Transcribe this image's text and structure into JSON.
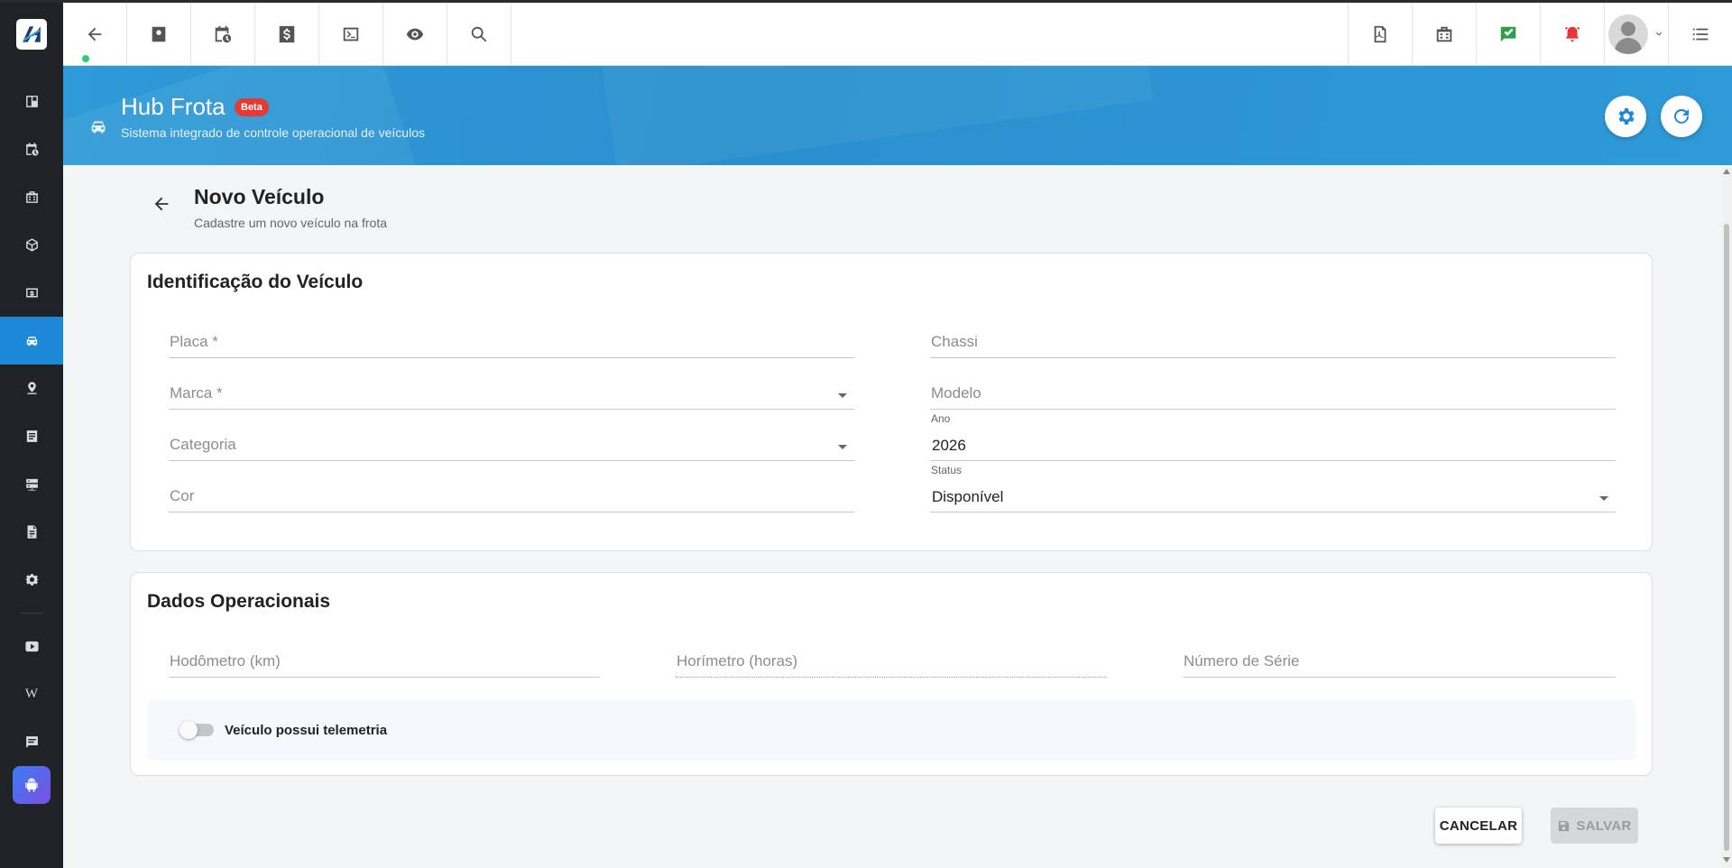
{
  "app": {
    "title": "Hub Frota",
    "badge": "Beta",
    "subtitle": "Sistema integrado de controle operacional de veículos"
  },
  "sidebar": {
    "items": [
      {
        "icon": "dashboard-icon"
      },
      {
        "icon": "calendar-clock-icon"
      },
      {
        "icon": "building-icon"
      },
      {
        "icon": "box-icon"
      },
      {
        "icon": "money-icon"
      },
      {
        "icon": "car-icon",
        "active": true
      },
      {
        "icon": "map-pin-icon"
      },
      {
        "icon": "list-icon"
      },
      {
        "icon": "server-icon"
      },
      {
        "icon": "document-icon"
      },
      {
        "icon": "gear-icon"
      },
      {
        "icon": "youtube-icon"
      },
      {
        "icon": "wikipedia-icon",
        "glyph": "W"
      },
      {
        "icon": "chat-icon"
      },
      {
        "icon": "android-icon"
      }
    ]
  },
  "topbar": {
    "left_icons": [
      "back-arrow-icon",
      "contact-card-icon",
      "calendar-clock-icon",
      "dollar-icon",
      "terminal-icon",
      "eye-icon",
      "search-icon"
    ],
    "right_icons": [
      "pdf-icon",
      "building-icon",
      "check-message-icon",
      "alarm-bell-icon",
      "user-avatar",
      "list-icon"
    ]
  },
  "page": {
    "title": "Novo Veículo",
    "subtitle": "Cadastre um novo veículo na frota"
  },
  "identification": {
    "heading": "Identificação do Veículo",
    "placa_placeholder": "Placa *",
    "chassi_placeholder": "Chassi",
    "marca_placeholder": "Marca *",
    "modelo_placeholder": "Modelo",
    "categoria_placeholder": "Categoria",
    "ano_label": "Ano",
    "ano_value": "2026",
    "cor_placeholder": "Cor",
    "status_label": "Status",
    "status_value": "Disponível"
  },
  "operational": {
    "heading": "Dados Operacionais",
    "hodometro_placeholder": "Hodômetro (km)",
    "horimetro_placeholder": "Horímetro (horas)",
    "serie_placeholder": "Número de Série",
    "telemetry_label": "Veículo possui telemetria",
    "telemetry_on": false
  },
  "actions": {
    "cancel_label": "CANCELAR",
    "save_label": "SALVAR"
  },
  "colors": {
    "accent": "#1e88d8",
    "sidebar": "#1f2328",
    "badge": "#e53935"
  }
}
